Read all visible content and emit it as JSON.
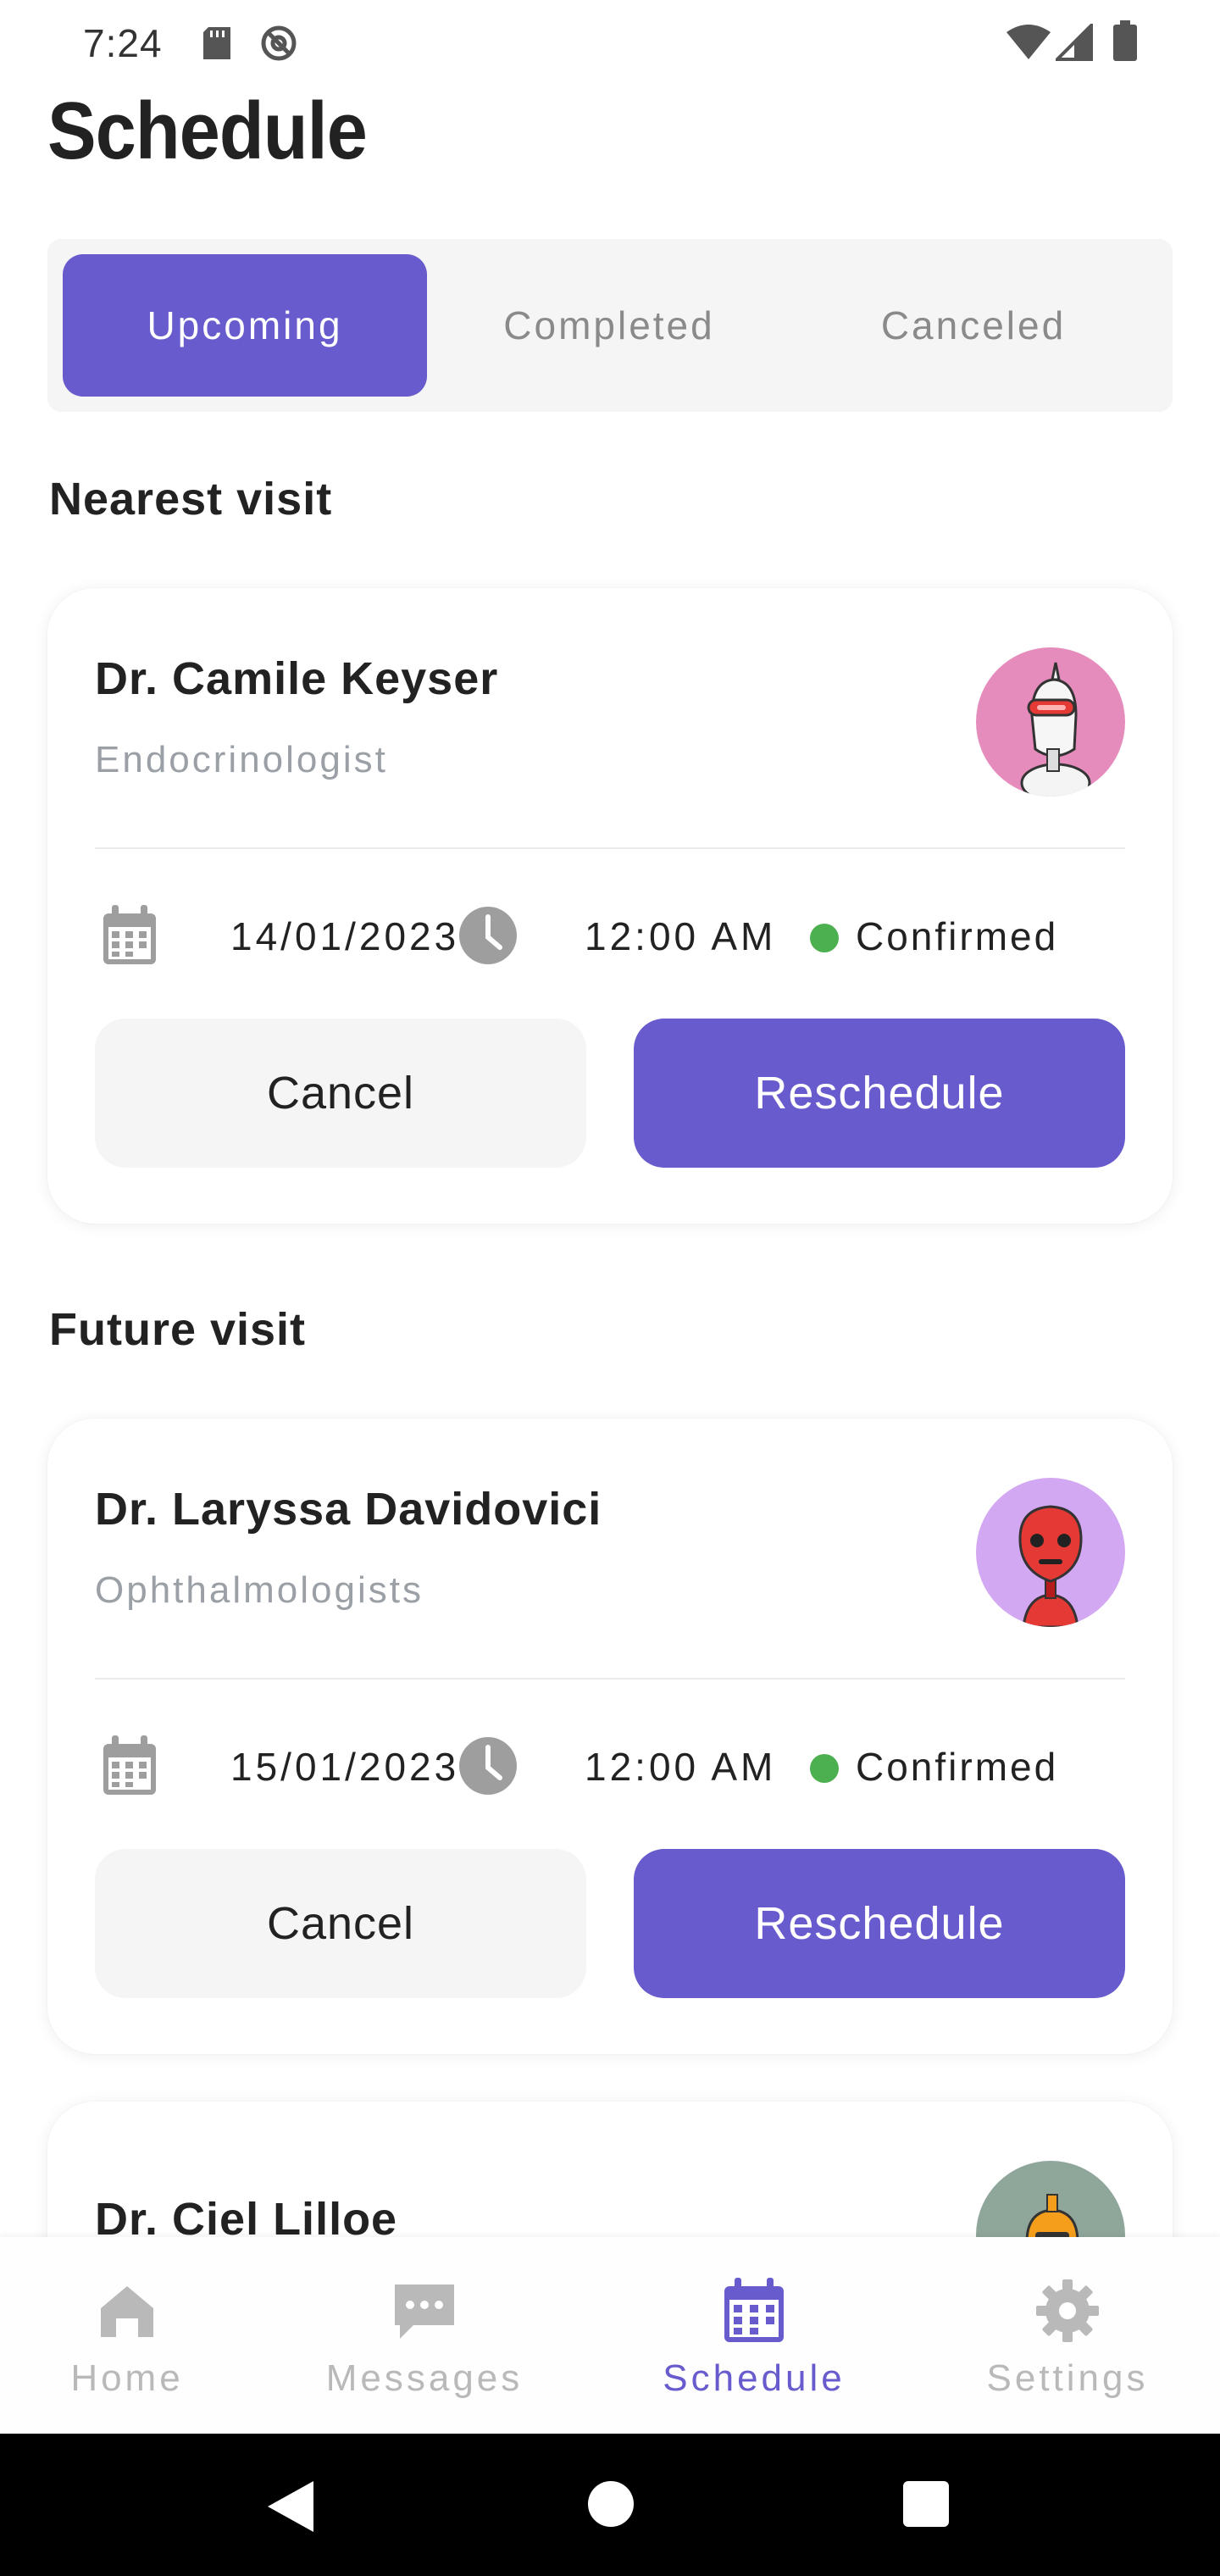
{
  "status_bar": {
    "time": "7:24"
  },
  "page": {
    "title": "Schedule"
  },
  "tabs": [
    {
      "label": "Upcoming",
      "active": true
    },
    {
      "label": "Completed",
      "active": false
    },
    {
      "label": "Canceled",
      "active": false
    }
  ],
  "sections": {
    "nearest_title": "Nearest visit",
    "future_title": "Future visit"
  },
  "appointments": [
    {
      "doctor": "Dr. Camile Keyser",
      "specialty": "Endocrinologist",
      "date": "14/01/2023",
      "time": "12:00 AM",
      "status": "Confirmed",
      "avatar_bg": "#e58cbc",
      "cancel_label": "Cancel",
      "reschedule_label": "Reschedule"
    },
    {
      "doctor": "Dr. Laryssa Davidovici",
      "specialty": "Ophthalmologists",
      "date": "15/01/2023",
      "time": "12:00 AM",
      "status": "Confirmed",
      "avatar_bg": "#d3a8f2",
      "cancel_label": "Cancel",
      "reschedule_label": "Reschedule"
    },
    {
      "doctor": "Dr. Ciel Lilloe",
      "avatar_bg": "#8fa69b"
    }
  ],
  "bottom_nav": [
    {
      "label": "Home",
      "icon": "home-icon",
      "active": false
    },
    {
      "label": "Messages",
      "icon": "chat-icon",
      "active": false
    },
    {
      "label": "Schedule",
      "icon": "calendar-icon",
      "active": true
    },
    {
      "label": "Settings",
      "icon": "gear-icon",
      "active": false
    }
  ],
  "colors": {
    "accent": "#675bcd",
    "confirmed": "#4caf50",
    "muted_text": "#9aa0a6",
    "inactive_nav": "#b9b9b9"
  }
}
